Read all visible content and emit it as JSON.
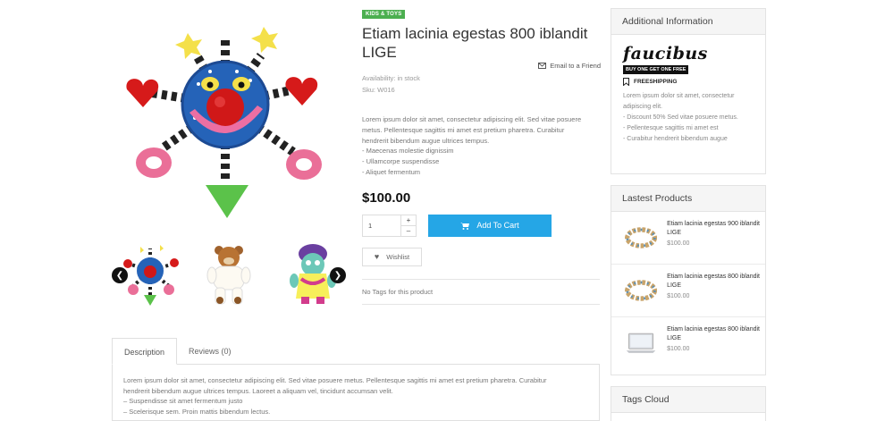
{
  "product": {
    "category": "KIDS & TOYS",
    "title": "Etiam lacinia egestas 800 iblandit LIGE",
    "email_link": "Email to a Friend",
    "availability_label": "Availability:",
    "availability_value": "in stock",
    "sku_label": "Sku:",
    "sku_value": "W016",
    "short_description": [
      "Lorem ipsum dolor sit amet, consectetur adipiscing elit. Sed vitae posuere",
      "metus. Pellentesque sagittis mi amet est pretium pharetra. Curabitur",
      "hendrerit bibendum augue ultrices tempus.",
      "- Maecenas molestie dignissim",
      "- Ullamcorpe suspendisse",
      "- Aliquet fermentum"
    ],
    "price": "$100.00",
    "quantity": "1",
    "qty_plus": "+",
    "qty_minus": "–",
    "add_to_cart": "Add To Cart",
    "wishlist": "Wishlist",
    "tags_text": "No Tags for this product"
  },
  "gallery": {
    "prev_icon": "chevron-left-icon",
    "next_icon": "chevron-right-icon"
  },
  "tabs": {
    "items": [
      "Description",
      "Reviews (0)"
    ],
    "description": [
      "Lorem ipsum dolor sit amet, consectetur adipiscing elit. Sed vitae posuere metus. Pellentesque sagittis mi amet est pretium pharetra. Curabitur",
      "hendrerit bibendum augue ultrices tempus. Laoreet a aliquam vel, tincidunt accumsan velit.",
      "– Suspendisse sit amet fermentum justo",
      "– Scelerisque sem. Proin mattis bibendum lectus."
    ]
  },
  "sidebar": {
    "additional": {
      "title": "Additional Information",
      "brand": "faucibus",
      "promo": "BUY ONE GET ONE FREE",
      "freeshipping": "FREESHIPPING",
      "text": [
        "Lorem ipsum dolor sit amet, consectetur",
        "adipiscing elit.",
        "- Discount 50% Sed vitae posuere metus.",
        "- Pellentesque sagittis mi amet est",
        "- Curabitur hendrerit bibendum augue"
      ]
    },
    "latest": {
      "title": "Lastest Products",
      "items": [
        {
          "name": "Etiam lacinia egestas 900 iblandit LIGE",
          "price": "$100.00",
          "image": "bracelet"
        },
        {
          "name": "Etiam lacinia egestas 800 iblandit LIGE",
          "price": "$100.00",
          "image": "bracelet"
        },
        {
          "name": "Etiam lacinia egestas 800 iblandit LIGE",
          "price": "$100.00",
          "image": "laptop"
        }
      ]
    },
    "tags_cloud": {
      "title": "Tags Cloud"
    }
  },
  "colors": {
    "accent": "#25a6e6",
    "badge": "#4caf50"
  }
}
